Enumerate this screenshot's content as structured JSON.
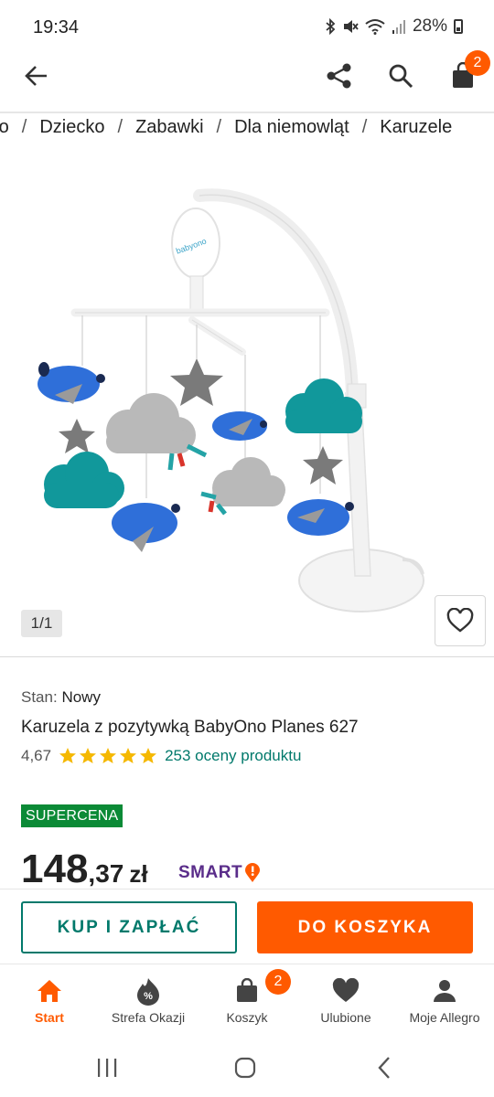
{
  "status_bar": {
    "time": "19:34",
    "battery": "28%"
  },
  "app_bar": {
    "back_icon": "arrow-left-icon",
    "share_icon": "share-icon",
    "search_icon": "search-icon",
    "cart_icon": "shopping-bag-icon",
    "cart_count": "2"
  },
  "breadcrumb": [
    "ro",
    "Dziecko",
    "Zabawki",
    "Dla niemowląt",
    "Karuzele"
  ],
  "gallery": {
    "counter": "1/1",
    "brand_on_image": "babyono"
  },
  "product": {
    "condition_label": "Stan:",
    "condition_value": "Nowy",
    "title": "Karuzela z pozytywką BabyOno Planes 627",
    "rating": "4,67",
    "stars": 5,
    "reviews_link": "253 oceny produktu",
    "promo_badge": "SUPERCENA",
    "price_int": "148",
    "price_frac": ",37",
    "currency": "zł",
    "smart_label": "SMART"
  },
  "actions": {
    "buy_now": "KUP I ZAPŁAĆ",
    "add_to_cart": "DO KOSZYKA"
  },
  "bottom_nav": {
    "items": [
      {
        "label": "Start",
        "icon": "home-icon",
        "active": true
      },
      {
        "label": "Strefa Okazji",
        "icon": "deals-icon"
      },
      {
        "label": "Koszyk",
        "icon": "shopping-bag-icon",
        "badge": "2"
      },
      {
        "label": "Ulubione",
        "icon": "heart-icon"
      },
      {
        "label": "Moje Allegro",
        "icon": "user-icon"
      }
    ]
  },
  "colors": {
    "accent": "#ff5a00",
    "teal": "#00796b",
    "supercena": "#0b8a36",
    "smart": "#5a2d8a",
    "star": "#f5b800"
  }
}
